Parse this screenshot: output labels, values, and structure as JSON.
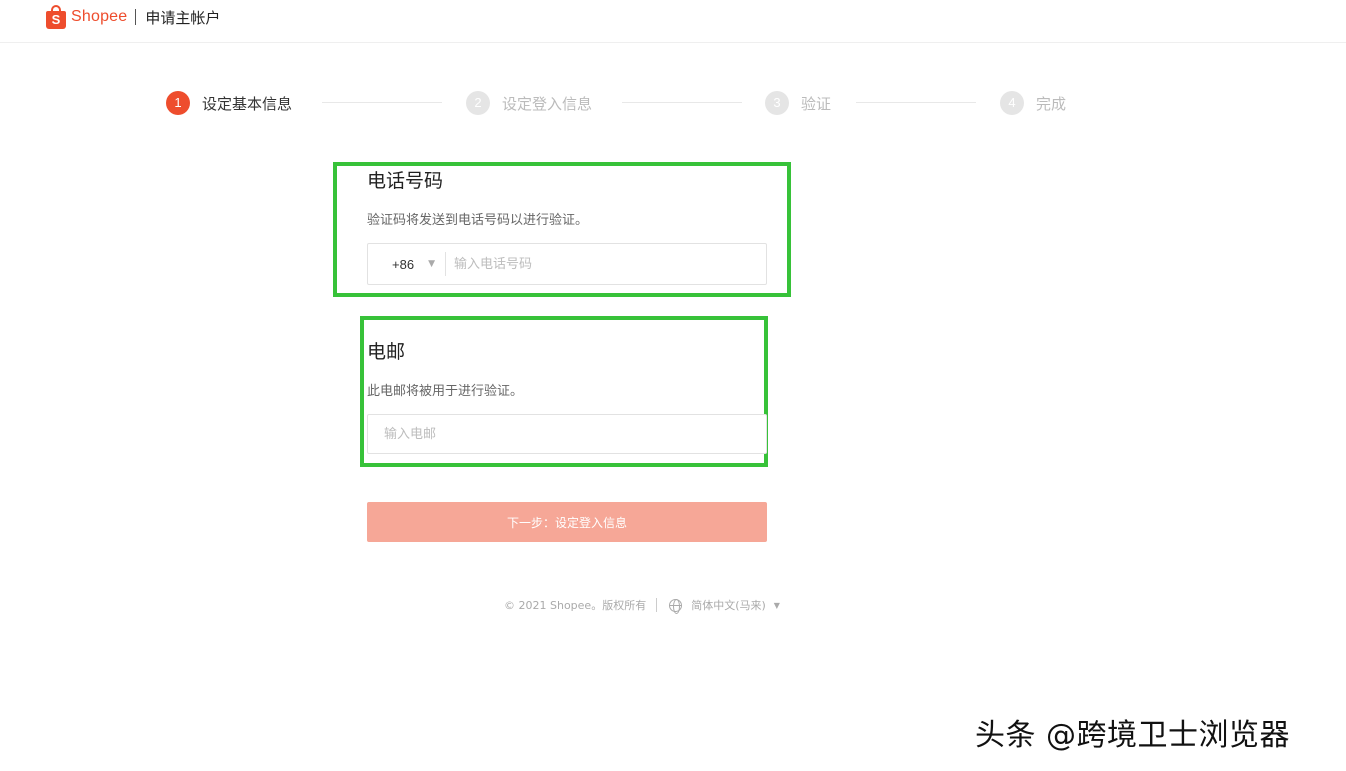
{
  "header": {
    "logo_letter": "S",
    "logo_text": "Shopee",
    "title": "申请主帐户"
  },
  "stepper": {
    "steps": [
      {
        "num": "1",
        "label": "设定基本信息",
        "active": true
      },
      {
        "num": "2",
        "label": "设定登入信息",
        "active": false
      },
      {
        "num": "3",
        "label": "验证",
        "active": false
      },
      {
        "num": "4",
        "label": "完成",
        "active": false
      }
    ]
  },
  "phone": {
    "title": "电话号码",
    "desc": "验证码将发送到电话号码以进行验证。",
    "country_code": "+86",
    "placeholder": "输入电话号码"
  },
  "email": {
    "title": "电邮",
    "desc": "此电邮将被用于进行验证。",
    "placeholder": "输入电邮"
  },
  "next_button": {
    "label": "下一步：设定登入信息"
  },
  "footer": {
    "copyright": "© 2021 Shopee。版权所有",
    "language": "简体中文(马来)"
  },
  "watermark": {
    "text": "头条 @跨境卫士浏览器"
  },
  "colors": {
    "brand": "#ee4d2d",
    "button_disabled": "#f6a797",
    "highlight": "#37c239"
  },
  "icons": {
    "globe": "globe-icon",
    "dropdown": "chevron-down-icon"
  }
}
